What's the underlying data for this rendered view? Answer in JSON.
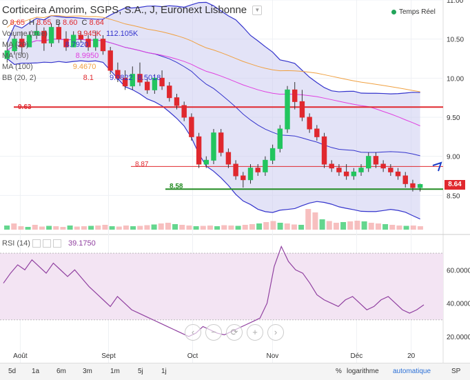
{
  "header": {
    "title": "Corticeira Amorim, SGPS, S.A., J, Euronext Lisbonne"
  },
  "ohlc": {
    "o_label": "O",
    "o": "8.65",
    "h_label": "H",
    "h": "8.65",
    "b_label": "B",
    "b": "8.60",
    "c_label": "C",
    "c": "8.64"
  },
  "indicators": {
    "volume": {
      "label": "Volume (true)",
      "v1": "9.945K",
      "v2": "112.105K"
    },
    "ma20": {
      "label": "MA (20)",
      "value": "8.7920"
    },
    "ma50": {
      "label": "MA (50)",
      "value": "8.9950"
    },
    "ma100": {
      "label": "MA (100)",
      "value": "9.4670"
    },
    "bb": {
      "label": "BB (20, 2)",
      "v1": "8.1",
      "v2": "9.0822",
      "v3": "8.5018"
    }
  },
  "realtime": {
    "label": "Temps Réel"
  },
  "price_tag": "8.64",
  "levels": [
    {
      "label": "9.63",
      "value": 9.63,
      "color": "#e0282e"
    },
    {
      "label": "8.87",
      "value": 8.87,
      "color": "#e0282e"
    },
    {
      "label": "8.58",
      "value": 8.58,
      "color": "#228b22"
    }
  ],
  "rsi": {
    "label": "RSI (14)",
    "value": "39.1750"
  },
  "zoom_controls": [
    "‹",
    "−",
    "⟳",
    "+",
    "›"
  ],
  "bottom_bar": {
    "timeframes": [
      "5d",
      "1a",
      "6m",
      "3m",
      "1m",
      "5j",
      "1j"
    ],
    "right": [
      "%",
      "logarithme",
      "automatique",
      "SP"
    ]
  },
  "colors": {
    "up": "#22c55e",
    "down": "#e0282e",
    "bb_fill": "#c8c8f0",
    "bb_line": "#3333cc",
    "ma20": "#3333cc",
    "ma50": "#e040e0",
    "ma100": "#f0a040",
    "rsi": "#9040a0",
    "rsi_band": "#f3e4f3"
  },
  "chart_data": {
    "type": "candlestick",
    "x_ticks": [
      "Août",
      "Sept",
      "Oct",
      "Nov",
      "Déc",
      "20"
    ],
    "y_ticks": [
      "11.00",
      "10.50",
      "10.00",
      "9.50",
      "9.00",
      "8.50"
    ],
    "ylim": [
      8.0,
      11.0
    ],
    "candles": [
      [
        10.25,
        10.45,
        10.2,
        10.35
      ],
      [
        10.35,
        10.55,
        10.3,
        10.5
      ],
      [
        10.5,
        10.6,
        10.3,
        10.4
      ],
      [
        10.4,
        10.6,
        10.4,
        10.55
      ],
      [
        10.55,
        10.7,
        10.5,
        10.6
      ],
      [
        10.6,
        10.65,
        10.35,
        10.45
      ],
      [
        10.45,
        10.7,
        10.4,
        10.65
      ],
      [
        10.65,
        10.7,
        10.45,
        10.5
      ],
      [
        10.5,
        10.6,
        10.35,
        10.4
      ],
      [
        10.4,
        10.6,
        10.4,
        10.55
      ],
      [
        10.55,
        10.6,
        10.45,
        10.5
      ],
      [
        10.5,
        10.55,
        10.35,
        10.4
      ],
      [
        10.4,
        10.6,
        10.35,
        10.5
      ],
      [
        10.5,
        10.55,
        10.3,
        10.35
      ],
      [
        10.35,
        10.4,
        10.05,
        10.1
      ],
      [
        10.1,
        10.2,
        9.95,
        10.0
      ],
      [
        10.0,
        10.1,
        9.85,
        9.9
      ],
      [
        9.9,
        10.15,
        9.85,
        10.05
      ],
      [
        10.05,
        10.2,
        9.9,
        9.95
      ],
      [
        9.95,
        10.0,
        9.8,
        9.85
      ],
      [
        9.85,
        10.05,
        9.8,
        10.0
      ],
      [
        10.0,
        10.1,
        9.85,
        9.9
      ],
      [
        9.9,
        9.95,
        9.7,
        9.75
      ],
      [
        9.75,
        9.8,
        9.6,
        9.65
      ],
      [
        9.65,
        9.7,
        9.45,
        9.5
      ],
      [
        9.5,
        9.55,
        9.2,
        9.25
      ],
      [
        9.25,
        9.3,
        8.85,
        8.9
      ],
      [
        8.9,
        9.0,
        8.85,
        8.95
      ],
      [
        8.95,
        9.35,
        8.9,
        9.3
      ],
      [
        9.3,
        9.35,
        9.0,
        9.05
      ],
      [
        9.05,
        9.1,
        8.85,
        8.9
      ],
      [
        8.9,
        8.95,
        8.7,
        8.75
      ],
      [
        8.75,
        8.8,
        8.6,
        8.7
      ],
      [
        8.7,
        8.9,
        8.65,
        8.85
      ],
      [
        8.85,
        8.9,
        8.75,
        8.8
      ],
      [
        8.8,
        9.0,
        8.75,
        8.95
      ],
      [
        8.95,
        9.15,
        8.9,
        9.1
      ],
      [
        9.1,
        9.4,
        9.05,
        9.35
      ],
      [
        9.35,
        9.9,
        9.3,
        9.85
      ],
      [
        9.85,
        9.95,
        9.6,
        9.7
      ],
      [
        9.7,
        9.85,
        9.45,
        9.5
      ],
      [
        9.5,
        9.55,
        9.3,
        9.35
      ],
      [
        9.35,
        9.4,
        9.2,
        9.25
      ],
      [
        9.25,
        9.3,
        8.85,
        8.9
      ],
      [
        8.9,
        8.95,
        8.8,
        8.85
      ],
      [
        8.85,
        8.9,
        8.75,
        8.8
      ],
      [
        8.8,
        8.9,
        8.7,
        8.75
      ],
      [
        8.75,
        8.85,
        8.7,
        8.8
      ],
      [
        8.8,
        8.9,
        8.75,
        8.85
      ],
      [
        8.85,
        9.05,
        8.8,
        9.0
      ],
      [
        9.0,
        9.05,
        8.85,
        8.9
      ],
      [
        8.9,
        8.95,
        8.8,
        8.85
      ],
      [
        8.85,
        8.9,
        8.75,
        8.8
      ],
      [
        8.8,
        8.85,
        8.7,
        8.75
      ],
      [
        8.75,
        8.8,
        8.6,
        8.65
      ],
      [
        8.65,
        8.7,
        8.55,
        8.6
      ],
      [
        8.6,
        8.65,
        8.55,
        8.64
      ]
    ],
    "rsi_values": [
      52,
      58,
      63,
      60,
      66,
      62,
      58,
      64,
      60,
      56,
      60,
      55,
      50,
      46,
      42,
      38,
      44,
      40,
      36,
      34,
      32,
      30,
      28,
      26,
      24,
      22,
      20,
      22,
      26,
      24,
      22,
      21,
      23,
      25,
      27,
      29,
      31,
      40,
      62,
      74,
      65,
      60,
      58,
      52,
      45,
      42,
      40,
      38,
      42,
      44,
      40,
      36,
      38,
      42,
      44,
      40,
      36,
      34,
      36,
      39
    ],
    "rsi_ylim": [
      15,
      75
    ],
    "rsi_ticks": [
      "60.0000",
      "40.0000",
      "20.0000"
    ],
    "rsi_bands": [
      70,
      30
    ],
    "volume_values": [
      12,
      18,
      10,
      8,
      14,
      9,
      11,
      10,
      8,
      12,
      9,
      10,
      11,
      12,
      14,
      10,
      9,
      12,
      10,
      11,
      13,
      15,
      18,
      20,
      16,
      14,
      12,
      10,
      11,
      12,
      10,
      13,
      12,
      11,
      14,
      16,
      18,
      22,
      25,
      20,
      18,
      15,
      14,
      60,
      50,
      30,
      25,
      20,
      22,
      24,
      26,
      24,
      20,
      18,
      16,
      14,
      12,
      11,
      12,
      10
    ]
  }
}
